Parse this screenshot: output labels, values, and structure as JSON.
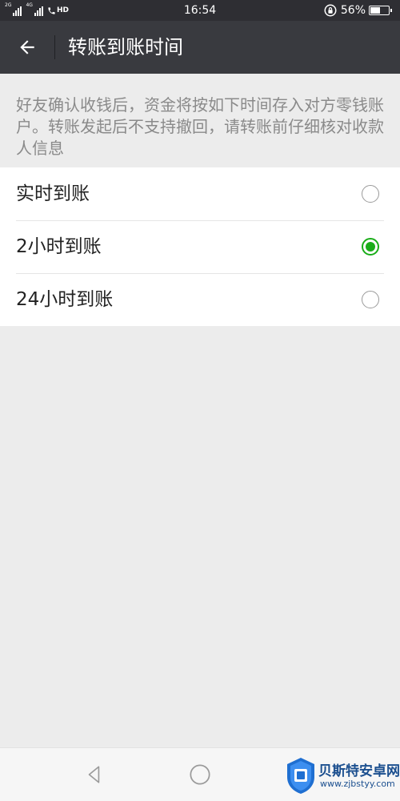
{
  "status_bar": {
    "network_1": "2G",
    "network_2": "4G",
    "hd_label": "HD",
    "time": "16:54",
    "battery_percent": "56%",
    "battery_level": 0.56,
    "icons": [
      "signal-icon",
      "signal-icon",
      "phone-hd-icon",
      "rotation-lock-icon",
      "battery-icon"
    ]
  },
  "header": {
    "title": "转账到账时间",
    "back_icon": "arrow-left-icon"
  },
  "description": "好友确认收钱后，资金将按如下时间存入对方零钱账户。转账发起后不支持撤回，请转账前仔细核对收款人信息",
  "options": [
    {
      "label": "实时到账",
      "selected": false
    },
    {
      "label": "2小时到账",
      "selected": true
    },
    {
      "label": "24小时到账",
      "selected": false
    }
  ],
  "colors": {
    "header_bg": "#393a3f",
    "status_bg": "#2e2e33",
    "page_bg": "#ececec",
    "accent_green": "#1aad19"
  },
  "nav_bar": {
    "icons": [
      "nav-back-icon",
      "nav-home-icon",
      "nav-recent-icon"
    ]
  },
  "watermark": {
    "text": "贝斯特安卓网",
    "url": "www.zjbstyy.com"
  }
}
